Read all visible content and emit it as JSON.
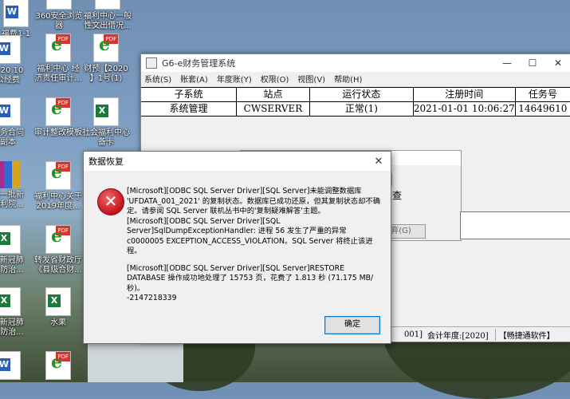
{
  "desktop_icons": [
    {
      "id": "i1",
      "label": "福费1-1",
      "type": "word"
    },
    {
      "id": "i2",
      "label": "360安全浏览器",
      "type": "e360"
    },
    {
      "id": "i3",
      "label": "福利中心一般\n性文出借况...",
      "type": "e360"
    },
    {
      "id": "i4",
      "label": "1-20.10\n公经费",
      "type": "word"
    },
    {
      "id": "i5",
      "label": "福利中心 经\n济责任审计...",
      "type": "pdf"
    },
    {
      "id": "i6",
      "label": "财预【2020\n】1号(1)",
      "type": "pdf"
    },
    {
      "id": "i7",
      "label": "服务合同\n副本",
      "type": "word"
    },
    {
      "id": "i8",
      "label": "审计整改模板",
      "type": "pdf"
    },
    {
      "id": "i9",
      "label": "社会福利中心\n备卡",
      "type": "excel"
    },
    {
      "id": "i10",
      "label": "第一批新\n福利院...",
      "type": "rar"
    },
    {
      "id": "i11",
      "label": "福利中心关于\n2019年度...",
      "type": "pdf"
    },
    {
      "id": "i12",
      "label": "3 新冠肺\n炎防治...",
      "type": "excel"
    },
    {
      "id": "i13",
      "label": "转发省财政厅\n《县级合财...",
      "type": "pdf"
    },
    {
      "id": "i14",
      "label": "4 新冠肺\n炎防治...",
      "type": "excel"
    },
    {
      "id": "i15",
      "label": "水果",
      "type": "excel"
    }
  ],
  "app_window": {
    "title": "G6-e财务管理系统",
    "menu": [
      "系统(S)",
      "账套(A)",
      "年度账(Y)",
      "权限(O)",
      "视图(V)",
      "帮助(H)"
    ],
    "columns": [
      "子系统",
      "站点",
      "运行状态",
      "注册时间",
      "任务号"
    ],
    "rows": [
      [
        "系统管理",
        "CWSERVER",
        "正常(1)",
        "2021-01-01 10:06:27",
        "14649610"
      ]
    ],
    "inner_panel": {
      "checkbox_text": "查",
      "abandon_button": "放弃(G)"
    },
    "status": {
      "fiscal_suffix": "001]",
      "fiscal_year": "会计年度:[2020]",
      "brand": "【畅捷通软件】"
    }
  },
  "dialog": {
    "title": "数据恢复",
    "close": "✕",
    "messages": [
      "[Microsoft][ODBC SQL Server Driver][SQL Server]未能调整数据库 'UFDATA_001_2021' 的复制状态。数据库已成功还原，但其复制状态却不确定。请参阅 SQL Server 联机丛书中的'复制疑难解答'主题。\n[Microsoft][ODBC SQL Server Driver][SQL Server]SqlDumpExceptionHandler: 进程 56 发生了严重的异常 c0000005 EXCEPTION_ACCESS_VIOLATION。SQL Server 将终止该进程。",
      "[Microsoft][ODBC SQL Server Driver][SQL Server]RESTORE DATABASE 操作成功地处理了 15753 页，花费了 1.813 秒 (71.175 MB/秒)。\n-2147218339"
    ],
    "ok_label": "确定"
  }
}
